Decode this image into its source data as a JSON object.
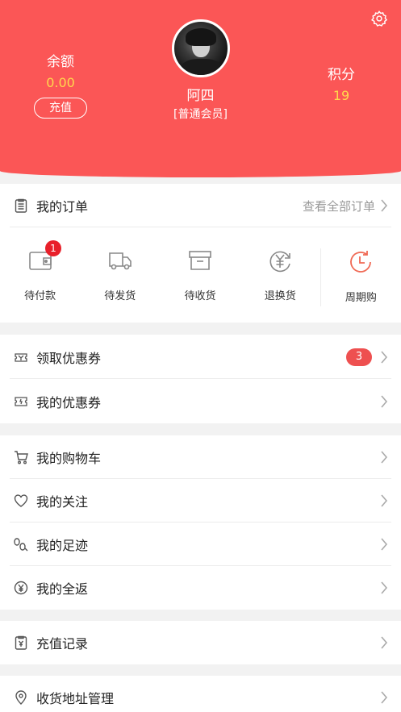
{
  "header": {
    "balance_label": "余额",
    "balance_value": "0.00",
    "recharge_button": "充值",
    "username": "阿四",
    "member_level": "[普通会员]",
    "points_label": "积分",
    "points_value": "19"
  },
  "orders": {
    "title": "我的订单",
    "view_all": "查看全部订单",
    "items": [
      {
        "label": "待付款",
        "badge": "1"
      },
      {
        "label": "待发货"
      },
      {
        "label": "待收货"
      },
      {
        "label": "退换货"
      },
      {
        "label": "周期购"
      }
    ]
  },
  "coupons": {
    "claim": "领取优惠券",
    "claim_count": "3",
    "mine": "我的优惠券"
  },
  "menu1": [
    "我的购物车",
    "我的关注",
    "我的足迹",
    "我的全返"
  ],
  "recharge_records": "充值记录",
  "address": "收货地址管理",
  "colors": {
    "accent": "#fb5656",
    "highlight": "#ffd84d",
    "badge": "#e8202a"
  }
}
